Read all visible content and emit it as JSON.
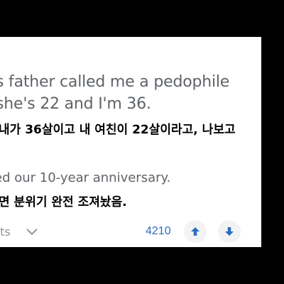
{
  "post": {
    "line1": "s father called me a pedophile",
    "line2": "she's 22 and I'm 36.",
    "line1_ko": "내가 36살이고 내 여친이 22살이라고, 나보고",
    "line3": "ed our 10-year anniversary.",
    "line3_ko": "면 분위기 완전 조져놨음."
  },
  "actions": {
    "comments_label": "nts",
    "score": "4210"
  },
  "colors": {
    "background": "#000000",
    "card": "#ffffff",
    "english_text": "#5f6368",
    "korean_text": "#000000",
    "muted": "#8c96a0",
    "accent": "#2a6fbf"
  },
  "icons": [
    "chevron-down-icon",
    "arrow-up-icon",
    "arrow-down-icon"
  ]
}
